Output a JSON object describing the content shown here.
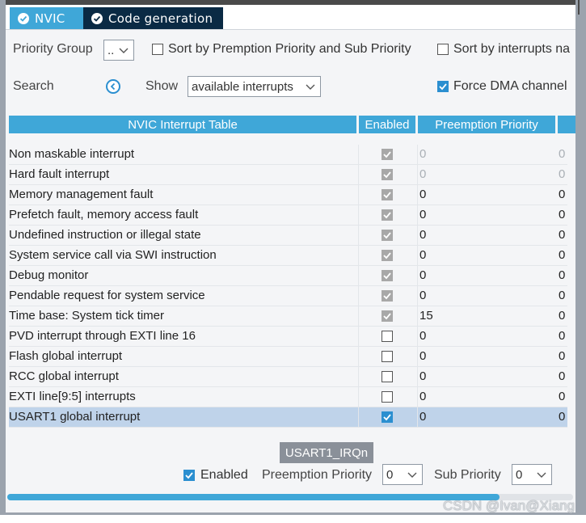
{
  "tabs": {
    "nvic": "NVIC",
    "code_generation": "Code generation"
  },
  "filters": {
    "priority_group_label": "Priority Group",
    "priority_group_value": "..",
    "sort_premption_label": "Sort by Premption Priority and Sub Priority",
    "sort_interrupts_label": "Sort by interrupts na",
    "search_label": "Search",
    "show_label": "Show",
    "show_value": "available interrupts",
    "force_dma_label": "Force DMA channel"
  },
  "table": {
    "headers": {
      "name": "NVIC Interrupt Table",
      "enabled": "Enabled",
      "preemption": "Preemption Priority"
    },
    "rows": [
      {
        "name": "Non maskable interrupt",
        "enabled": true,
        "locked": true,
        "preemption": "0",
        "sub": "0",
        "dim": true
      },
      {
        "name": "Hard fault interrupt",
        "enabled": true,
        "locked": true,
        "preemption": "0",
        "sub": "0",
        "dim": true
      },
      {
        "name": "Memory management fault",
        "enabled": true,
        "locked": true,
        "preemption": "0",
        "sub": "0",
        "dim": false
      },
      {
        "name": "Prefetch fault, memory access fault",
        "enabled": true,
        "locked": true,
        "preemption": "0",
        "sub": "0",
        "dim": false
      },
      {
        "name": "Undefined instruction or illegal state",
        "enabled": true,
        "locked": true,
        "preemption": "0",
        "sub": "0",
        "dim": false
      },
      {
        "name": "System service call via SWI instruction",
        "enabled": true,
        "locked": true,
        "preemption": "0",
        "sub": "0",
        "dim": false
      },
      {
        "name": "Debug monitor",
        "enabled": true,
        "locked": true,
        "preemption": "0",
        "sub": "0",
        "dim": false
      },
      {
        "name": "Pendable request for system service",
        "enabled": true,
        "locked": true,
        "preemption": "0",
        "sub": "0",
        "dim": false
      },
      {
        "name": "Time base: System tick timer",
        "enabled": true,
        "locked": true,
        "preemption": "15",
        "sub": "0",
        "dim": false
      },
      {
        "name": "PVD interrupt through EXTI line 16",
        "enabled": false,
        "locked": false,
        "preemption": "0",
        "sub": "0",
        "dim": false
      },
      {
        "name": "Flash global interrupt",
        "enabled": false,
        "locked": false,
        "preemption": "0",
        "sub": "0",
        "dim": false
      },
      {
        "name": "RCC global interrupt",
        "enabled": false,
        "locked": false,
        "preemption": "0",
        "sub": "0",
        "dim": false
      },
      {
        "name": "EXTI line[9:5] interrupts",
        "enabled": false,
        "locked": false,
        "preemption": "0",
        "sub": "0",
        "dim": false
      },
      {
        "name": "USART1 global interrupt",
        "enabled": true,
        "locked": false,
        "preemption": "0",
        "sub": "0",
        "dim": false,
        "selected": true
      }
    ]
  },
  "detail": {
    "irq_name": "USART1_IRQn",
    "enabled_label": "Enabled",
    "preemption_label": "Preemption Priority",
    "preemption_value": "0",
    "sub_label": "Sub Priority",
    "sub_value": "0"
  },
  "scroll_progress": 0.87,
  "watermark": "CSDN @Ivan@Xiang",
  "colors": {
    "accent": "#3fa7d8",
    "dark_tab": "#0a2a44",
    "selected_row": "#bfd3ea"
  }
}
